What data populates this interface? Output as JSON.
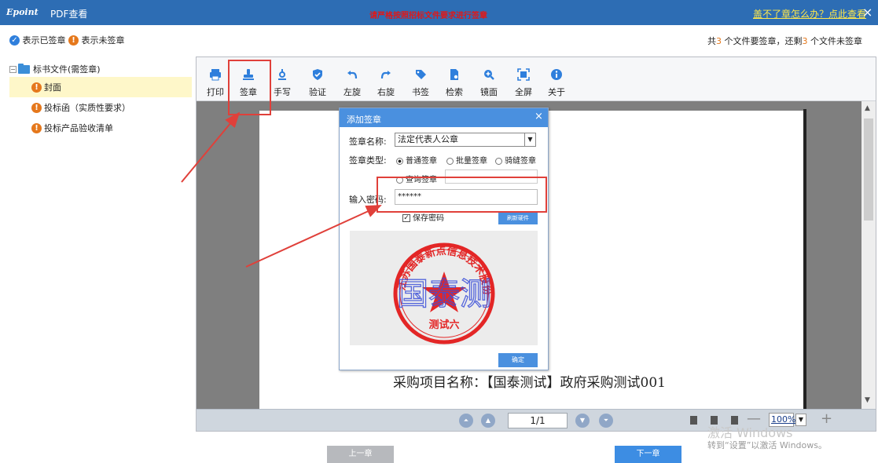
{
  "titlebar": {
    "logo": "Epoint",
    "title": "PDF查看",
    "warning": "请严格按照招标文件要求进行签章",
    "help_link": "盖不了章怎么办？点此查看",
    "close": "×"
  },
  "status": {
    "signed_label": "表示已签章",
    "unsigned_label": "表示未签章",
    "count_prefix": "共",
    "total": "3",
    "count_mid": "个文件要签章，还剩",
    "remaining": "3",
    "count_suffix": "个文件未签章"
  },
  "tree": {
    "root": "标书文件(需签章)",
    "items": [
      {
        "label": "封面",
        "selected": true
      },
      {
        "label": "投标函（实质性要求）",
        "selected": false
      },
      {
        "label": "投标产品验收清单",
        "selected": false
      }
    ]
  },
  "toolbar": {
    "tools": [
      {
        "label": "打印",
        "icon": "printer-icon"
      },
      {
        "label": "签章",
        "icon": "stamp-icon"
      },
      {
        "label": "手写",
        "icon": "handwrite-icon"
      },
      {
        "label": "验证",
        "icon": "shield-icon"
      },
      {
        "label": "左旋",
        "icon": "rotate-left-icon"
      },
      {
        "label": "右旋",
        "icon": "rotate-right-icon"
      },
      {
        "label": "书签",
        "icon": "bookmark-icon"
      },
      {
        "label": "检索",
        "icon": "search-doc-icon"
      },
      {
        "label": "镜面",
        "icon": "zoom-in-icon"
      },
      {
        "label": "全屏",
        "icon": "fullscreen-icon"
      },
      {
        "label": "关于",
        "icon": "info-icon"
      }
    ]
  },
  "dialog": {
    "title": "添加签章",
    "seal_name_label": "签章名称:",
    "seal_name_value": "法定代表人公章",
    "seal_type_label": "签章类型:",
    "seal_types": [
      "普通签章",
      "批量签章",
      "骑缝签章",
      "查询签章"
    ],
    "selected_seal_type": "普通签章",
    "password_label": "输入密码:",
    "password_value": "******",
    "save_password_label": "保存密码",
    "save_password_checked": true,
    "refresh_button": "刷新硬件",
    "confirm_button": "确定",
    "seal": {
      "arc_text": "江苏国泰新点信息技术股份有限公司",
      "center_text": "测试六",
      "signature": "国泰测"
    }
  },
  "document": {
    "text": "采购项目名称：【国泰测试】政府采购测试001"
  },
  "pager": {
    "page_display": "1/1",
    "zoom": "100%",
    "zoom_minus": "—",
    "zoom_plus": "+"
  },
  "buttons": {
    "prev": "上一章",
    "next": "下一章"
  },
  "watermark": {
    "line1": "激活 Windows",
    "line2": "转到“设置”以激活 Windows。"
  },
  "colors": {
    "titlebar": "#2d6db4",
    "accent": "#2f7fdc",
    "warning": "#e01818",
    "unsigned": "#e5781c",
    "annotation": "#e0403a"
  }
}
